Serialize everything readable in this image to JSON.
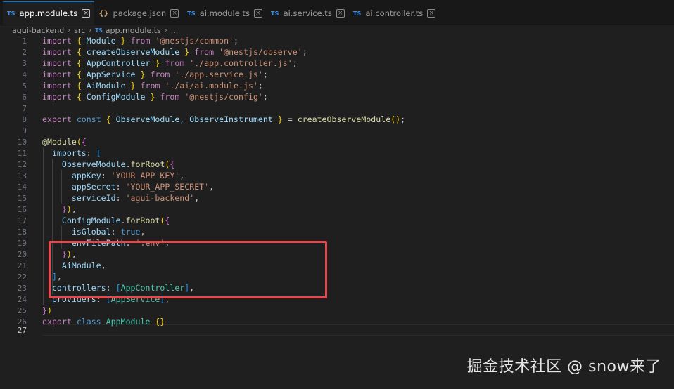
{
  "tabs": [
    {
      "label": "app.module.ts",
      "type": "TS",
      "active": true
    },
    {
      "label": "package.json",
      "type": "{}",
      "active": false
    },
    {
      "label": "ai.module.ts",
      "type": "TS",
      "active": false
    },
    {
      "label": "ai.service.ts",
      "type": "TS",
      "active": false
    },
    {
      "label": "ai.controller.ts",
      "type": "TS",
      "active": false
    }
  ],
  "breadcrumb": {
    "items": [
      "agui-backend",
      "src",
      "app.module.ts",
      "..."
    ],
    "file_type": "TS"
  },
  "editor": {
    "line_numbers": [
      "1",
      "2",
      "3",
      "4",
      "5",
      "6",
      "7",
      "8",
      "9",
      "10",
      "11",
      "12",
      "13",
      "14",
      "15",
      "16",
      "17",
      "18",
      "19",
      "20",
      "21",
      "22",
      "23",
      "24",
      "25",
      "26",
      "27"
    ],
    "lines": {
      "l1": {
        "kw": "import",
        "b1": "{",
        "id": " Module ",
        "b2": "}",
        "from": "from",
        "str": "'@nestjs/common'",
        "end": ";"
      },
      "l2": {
        "kw": "import",
        "b1": "{",
        "id": " createObserveModule ",
        "b2": "}",
        "from": "from",
        "str": "'@nestjs/observe'",
        "end": ";"
      },
      "l3": {
        "kw": "import",
        "b1": "{",
        "id": " AppController ",
        "b2": "}",
        "from": "from",
        "str": "'./app.controller.js'",
        "end": ";"
      },
      "l4": {
        "kw": "import",
        "b1": "{",
        "id": " AppService ",
        "b2": "}",
        "from": "from",
        "str": "'./app.service.js'",
        "end": ";"
      },
      "l5": {
        "kw": "import",
        "b1": "{",
        "id": " AiModule ",
        "b2": "}",
        "from": "from",
        "str": "'./ai/ai.module.js'",
        "end": ";"
      },
      "l6": {
        "kw": "import",
        "b1": "{",
        "id": " ConfigModule ",
        "b2": "}",
        "from": "from",
        "str": "'@nestjs/config'",
        "end": ";"
      },
      "l8": {
        "kw1": "export",
        "kw2": "const",
        "b1": "{",
        "id": " ObserveModule, ObserveInstrument ",
        "b2": "}",
        "eq": " = ",
        "fn": "createObserveModule",
        "call": "()",
        "end": ";"
      },
      "l10": {
        "dec": "@Module",
        "p": "(",
        "b": "{"
      },
      "l11": {
        "prop": "imports",
        "colon": ": ",
        "b": "["
      },
      "l12": {
        "obj": "ObserveModule",
        "dot": ".",
        "fn": "forRoot",
        "p": "(",
        "b": "{"
      },
      "l13": {
        "prop": "appKey",
        "colon": ": ",
        "str": "'YOUR_APP_KEY'",
        "end": ","
      },
      "l14": {
        "prop": "appSecret",
        "colon": ": ",
        "str": "'YOUR_APP_SECRET'",
        "end": ","
      },
      "l15": {
        "prop": "serviceId",
        "colon": ": ",
        "str": "'agui-backend'",
        "end": ","
      },
      "l16": {
        "b": "}",
        "p": ")",
        "end": ","
      },
      "l17": {
        "obj": "ConfigModule",
        "dot": ".",
        "fn": "forRoot",
        "p": "(",
        "b": "{"
      },
      "l18": {
        "prop": "isGlobal",
        "colon": ": ",
        "val": "true",
        "end": ","
      },
      "l19": {
        "prop": "envFilePath",
        "colon": ": ",
        "str": "'.env'",
        "end": ","
      },
      "l20": {
        "b": "}",
        "p": ")",
        "end": ","
      },
      "l21": {
        "obj": "AiModule",
        "end": ","
      },
      "l22": {
        "b": "]",
        "end": ","
      },
      "l23": {
        "prop": "controllers",
        "colon": ": ",
        "b1": "[",
        "val": "AppController",
        "b2": "]",
        "end": ","
      },
      "l24": {
        "prop": "providers",
        "colon": ": ",
        "b1": "[",
        "val": "AppService",
        "b2": "]",
        "end": ","
      },
      "l25": {
        "b": "}",
        "p": ")"
      },
      "l26": {
        "kw1": "export",
        "kw2": "class",
        "name": " AppModule ",
        "b": "{}"
      }
    }
  },
  "watermark": "掘金技术社区 @ snow来了",
  "colors": {
    "highlight_box": "#e5484d",
    "tab_accent": "#0078d4"
  }
}
